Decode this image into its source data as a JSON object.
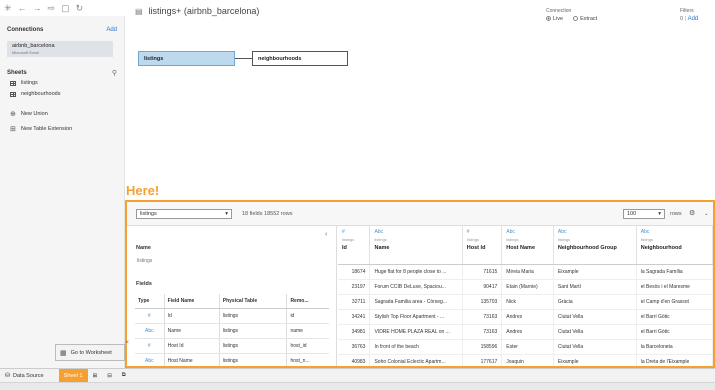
{
  "toolbar": {
    "icons": [
      "tableau-logo-icon",
      "back-icon",
      "forward-icon",
      "redo-icon",
      "save-icon",
      "refresh-icon"
    ],
    "glyphs": [
      "✳",
      "←",
      "→",
      "⇨",
      "▢",
      "↻"
    ]
  },
  "sidebar": {
    "connections_title": "Connections",
    "add_label": "Add",
    "connection_name": "airbnb_barcelona",
    "connection_type": "Microsoft Excel",
    "sheets_title": "Sheets",
    "search_glyph": "⚲",
    "sheets": [
      "listings",
      "neighbourhoods"
    ],
    "new_union": "New Union",
    "new_table_extension": "New Table Extension"
  },
  "datasource": {
    "title": "listings+ (airbnb_barcelona)",
    "connection_label": "Connection",
    "live": "Live",
    "extract": "Extract",
    "filters_label": "Filters",
    "filters_count": "0",
    "filters_add": "Add"
  },
  "canvas": {
    "left_table": "listings",
    "right_table": "neighbourhoods"
  },
  "annotation": "Here!",
  "grid": {
    "table_select": "listings",
    "summary": "18 fields 18552 rows",
    "rows_value": "100",
    "rows_label": "rows",
    "name_label": "Name",
    "name_value": "listings",
    "fields_label": "Fields",
    "field_headers": [
      "Type",
      "Field Name",
      "Physical Table",
      "Remo..."
    ],
    "fields": [
      {
        "type": "#",
        "name": "Id",
        "table": "listings",
        "remote": "id"
      },
      {
        "type": "Abc",
        "name": "Name",
        "table": "listings",
        "remote": "name"
      },
      {
        "type": "#",
        "name": "Host Id",
        "table": "listings",
        "remote": "host_id"
      },
      {
        "type": "Abc",
        "name": "Host Name",
        "table": "listings",
        "remote": "host_n..."
      }
    ],
    "columns": [
      {
        "type": "#",
        "src": "listings",
        "name": "Id"
      },
      {
        "type": "Abc",
        "src": "listings",
        "name": "Name"
      },
      {
        "type": "#",
        "src": "listings",
        "name": "Host Id"
      },
      {
        "type": "Abc",
        "src": "listings",
        "name": "Host Name"
      },
      {
        "type": "Abc",
        "src": "listings",
        "name": "Neighbourhood Group"
      },
      {
        "type": "Abc",
        "src": "listings",
        "name": "Neighbourhood"
      }
    ],
    "rows": [
      [
        "18674",
        "Huge flat for 8 people close to ...",
        "71615",
        "Mireia Maria",
        "Eixample",
        "la Sagrada Família"
      ],
      [
        "23197",
        "Forum CCIB DeLuxe, Spaciou...",
        "90417",
        "Etain (Marnie)",
        "Sant Martí",
        "el Besòs i el Maresme"
      ],
      [
        "32711",
        "Sagrada Familia area - Còrseg...",
        "135703",
        "Nick",
        "Gràcia",
        "el Camp d'en Grassot"
      ],
      [
        "34241",
        "Stylish Top Floor Apartment - ...",
        "73163",
        "Andres",
        "Ciutat Vella",
        "el Barri Gòtic"
      ],
      [
        "34981",
        "VIDRE HOME PLAZA REAL on ...",
        "73163",
        "Andres",
        "Ciutat Vella",
        "el Barri Gòtic"
      ],
      [
        "36763",
        "In front of the beach",
        "158596",
        "Ester",
        "Ciutat Vella",
        "la Barceloneta"
      ],
      [
        "40983",
        "Soho Colonial Eclectic Apartm...",
        "177617",
        "Joaquin",
        "Eixample",
        "la Dreta de l'Eixample"
      ]
    ]
  },
  "tooltip": {
    "label": "Go to Worksheet"
  },
  "tabs": {
    "data_source": "Data Source",
    "sheet1": "Sheet 1"
  }
}
